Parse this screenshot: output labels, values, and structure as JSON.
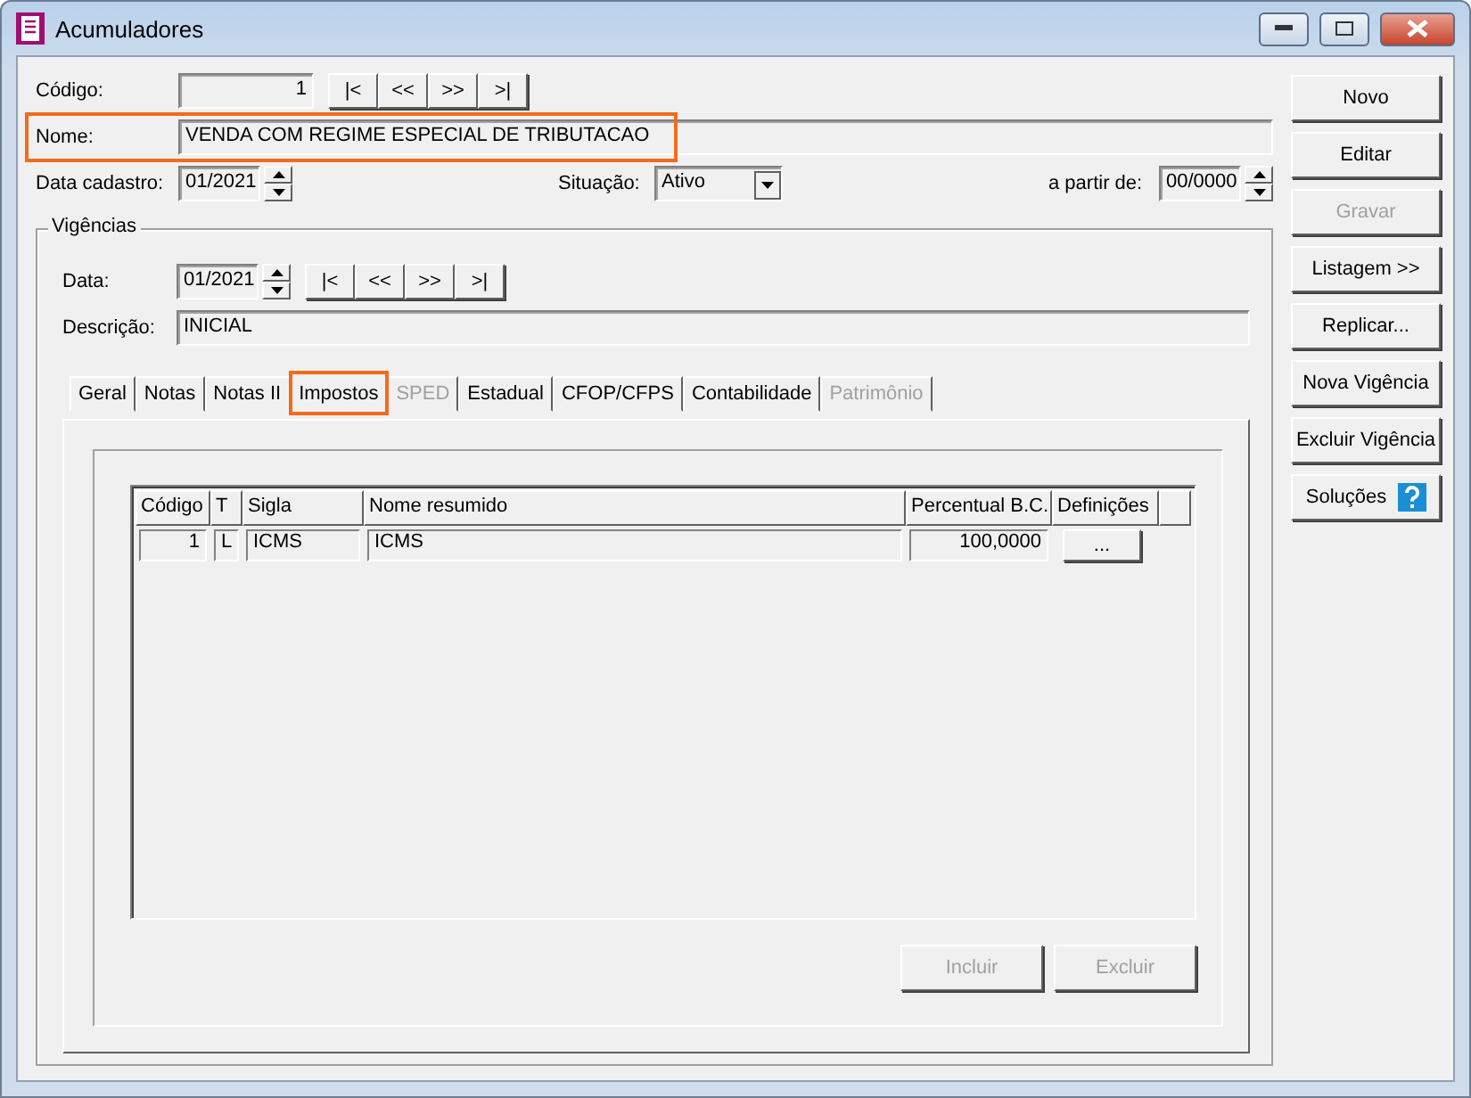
{
  "window": {
    "title": "Acumuladores"
  },
  "form": {
    "codigo": {
      "label": "Código:",
      "value": "1"
    },
    "nav_buttons": [
      "|<",
      "<<",
      ">>",
      ">|"
    ],
    "nome": {
      "label": "Nome:",
      "value": "VENDA COM REGIME ESPECIAL DE TRIBUTACAO",
      "highlighted": true
    },
    "data_cadastro": {
      "label": "Data cadastro:",
      "value": "01/2021"
    },
    "situacao": {
      "label": "Situação:",
      "value": "Ativo"
    },
    "a_partir_de": {
      "label": "a partir de:",
      "value": "00/0000"
    }
  },
  "vigencias": {
    "title": "Vigências",
    "data": {
      "label": "Data:",
      "value": "01/2021"
    },
    "nav_buttons": [
      "|<",
      "<<",
      ">>",
      ">|"
    ],
    "descricao": {
      "label": "Descrição:",
      "value": "INICIAL"
    },
    "tabs": [
      {
        "label": "Geral",
        "selected": false,
        "disabled": false,
        "highlighted": false
      },
      {
        "label": "Notas",
        "selected": false,
        "disabled": false,
        "highlighted": false
      },
      {
        "label": "Notas II",
        "selected": false,
        "disabled": false,
        "highlighted": false
      },
      {
        "label": "Impostos",
        "selected": true,
        "disabled": false,
        "highlighted": true
      },
      {
        "label": "SPED",
        "selected": false,
        "disabled": true,
        "highlighted": false
      },
      {
        "label": "Estadual",
        "selected": false,
        "disabled": false,
        "highlighted": false
      },
      {
        "label": "CFOP/CFPS",
        "selected": false,
        "disabled": false,
        "highlighted": false
      },
      {
        "label": "Contabilidade",
        "selected": false,
        "disabled": false,
        "highlighted": false
      },
      {
        "label": "Patrimônio",
        "selected": false,
        "disabled": true,
        "highlighted": false
      }
    ],
    "table": {
      "columns": [
        "Código",
        "T",
        "Sigla",
        "Nome resumido",
        "Percentual B.C.",
        "Definições"
      ],
      "rows": [
        {
          "codigo": "1",
          "t": "L",
          "sigla": "ICMS",
          "nome_resumido": "ICMS",
          "percentual": "100,0000",
          "definicoes": "..."
        }
      ]
    },
    "buttons": [
      {
        "label": "Incluir",
        "disabled": true
      },
      {
        "label": "Excluir",
        "disabled": true
      }
    ]
  },
  "side_buttons": [
    {
      "label": "Novo",
      "disabled": false,
      "kind": "plain"
    },
    {
      "label": "Editar",
      "disabled": false,
      "kind": "plain"
    },
    {
      "label": "Gravar",
      "disabled": true,
      "kind": "plain"
    },
    {
      "label": "Listagem >>",
      "disabled": false,
      "kind": "plain"
    },
    {
      "label": "Replicar...",
      "disabled": false,
      "kind": "plain"
    },
    {
      "label": "Nova Vigência",
      "disabled": false,
      "kind": "plain"
    },
    {
      "label": "Excluir Vigência",
      "disabled": false,
      "kind": "plain"
    },
    {
      "label": "Soluções",
      "disabled": false,
      "kind": "help"
    }
  ]
}
